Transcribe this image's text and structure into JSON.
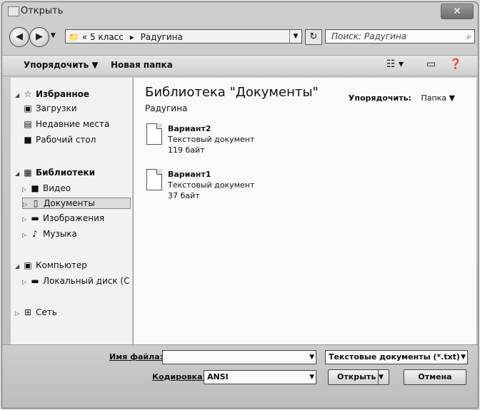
{
  "window": {
    "title": "Открыть"
  },
  "nav": {
    "path": [
      "5 класс",
      "Радугина"
    ],
    "path_prefix": "«",
    "search_placeholder": "Поиск: Радугина"
  },
  "toolbar": {
    "organize": "Упорядочить",
    "new_folder": "Новая папка"
  },
  "sidebar": {
    "favorites": "Избранное",
    "downloads": "Загрузки",
    "recent": "Недавние места",
    "desktop": "Рабочий стол",
    "libraries": "Библиотеки",
    "video": "Видео",
    "documents": "Документы",
    "images": "Изображения",
    "music": "Музыка",
    "computer": "Компьютер",
    "local_disk": "Локальный диск (C",
    "network": "Сеть"
  },
  "content": {
    "library_title": "Библиотека \"Документы\"",
    "library_subtitle": "Радугина",
    "arrange_label": "Упорядочить:",
    "arrange_value": "Папка",
    "files": [
      {
        "name": "Вариант2",
        "type": "Текстовый документ",
        "size": "119 байт"
      },
      {
        "name": "Вариант1",
        "type": "Текстовый документ",
        "size": "37 байт"
      }
    ]
  },
  "bottom": {
    "filename_label": "Имя файла:",
    "filename_value": "",
    "filetype_value": "Текстовые документы (*.txt)",
    "encoding_label": "Кодировка:",
    "encoding_value": "ANSI",
    "open_button": "Открыть",
    "cancel_button": "Отмена"
  }
}
